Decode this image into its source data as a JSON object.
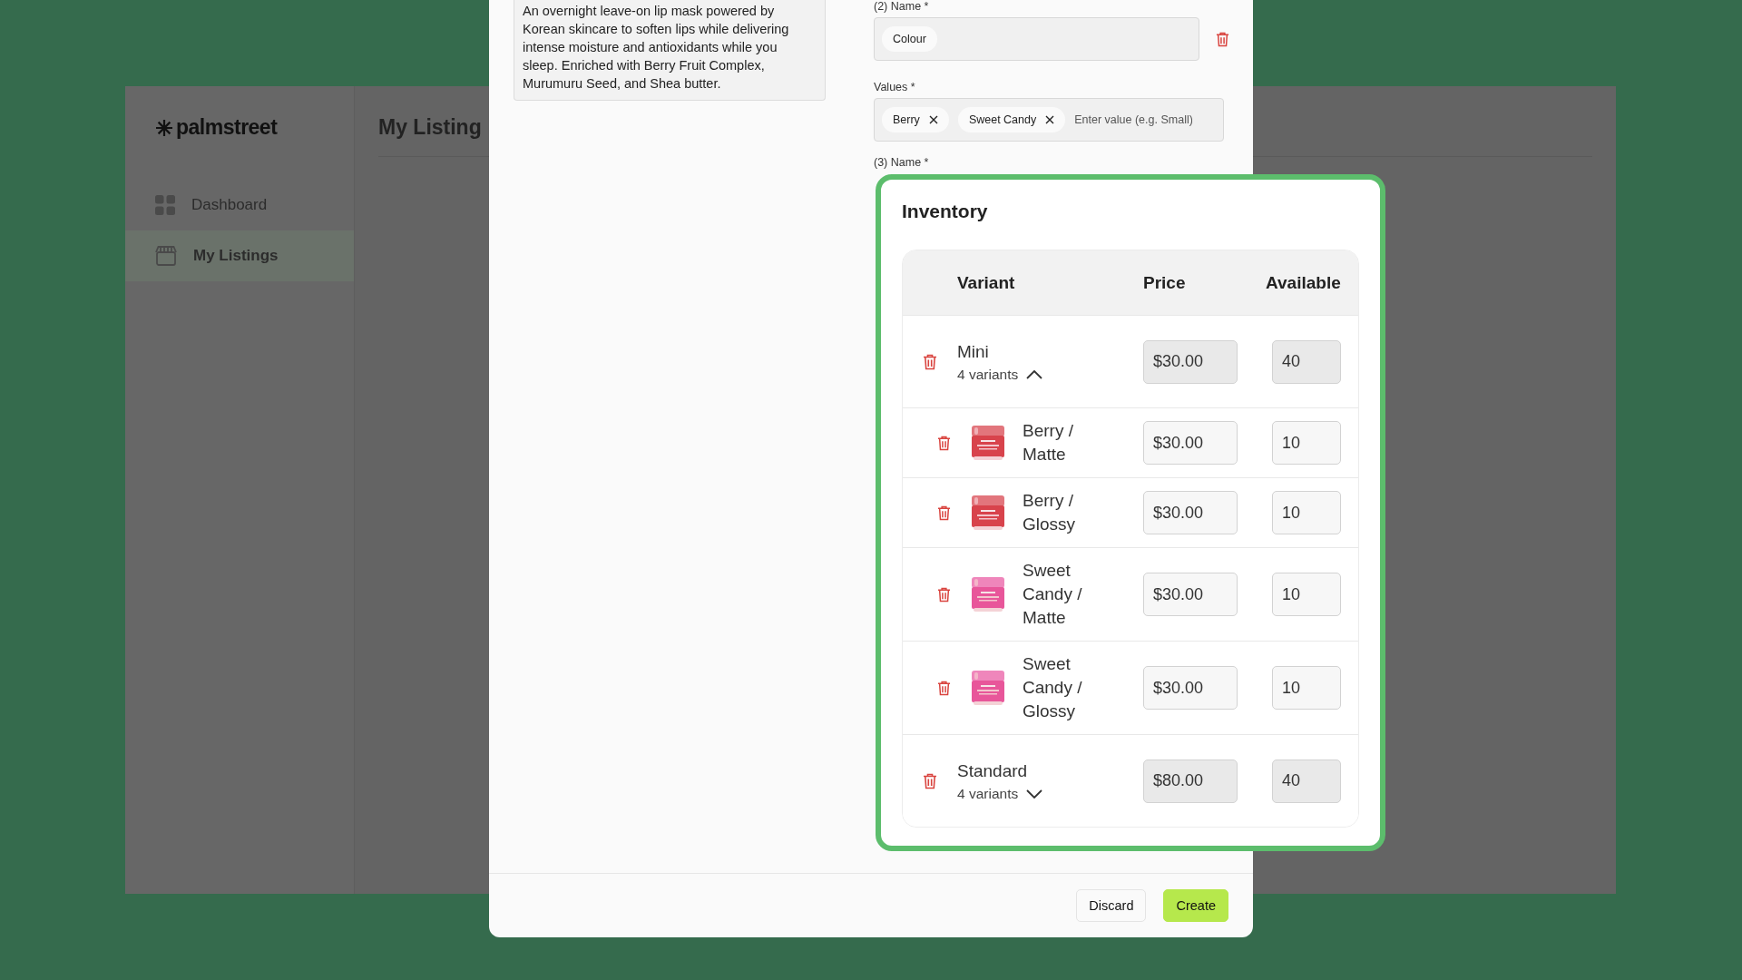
{
  "sidebar": {
    "logo": "palmstreet",
    "items": [
      {
        "label": "Dashboard",
        "kind": "dashboard",
        "selected": false
      },
      {
        "label": "My Listings",
        "kind": "listings",
        "selected": true
      }
    ]
  },
  "page": {
    "title": "My Listing"
  },
  "modal": {
    "description": "An overnight leave-on lip mask powered by Korean skincare to soften lips while delivering intense moisture and antioxidants while you sleep. Enriched with Berry Fruit Complex, Murumuru Seed, and Shea butter.",
    "option_name": {
      "label": "(2) Name *",
      "chip": "Colour"
    },
    "values": {
      "label": "Values *",
      "chips": [
        "Berry",
        "Sweet Candy"
      ],
      "placeholder": "Enter value (e.g. Small)"
    },
    "next_option_label": "(3) Name *",
    "buttons": [
      {
        "label": "Discard",
        "kind": "secondary"
      },
      {
        "label": "Create",
        "kind": "primary"
      }
    ]
  },
  "inventory": {
    "title": "Inventory",
    "columns": [
      "Variant",
      "Price",
      "Available"
    ],
    "rows": [
      {
        "kind": "group",
        "name": "Mini",
        "count": "4 variants",
        "expanded": true,
        "price": "$30.00",
        "available": "40",
        "children": [
          {
            "kind": "variant",
            "name": "Berry / Matte",
            "price": "$30.00",
            "available": "10"
          },
          {
            "kind": "variant",
            "name": "Berry / Glossy",
            "price": "$30.00",
            "available": "10"
          },
          {
            "kind": "variant",
            "name": "Sweet Candy / Matte",
            "price": "$30.00",
            "available": "10"
          },
          {
            "kind": "variant",
            "name": "Sweet Candy / Glossy",
            "price": "$30.00",
            "available": "10"
          }
        ]
      },
      {
        "kind": "group",
        "name": "Standard",
        "count": "4 variants",
        "expanded": false,
        "price": "$80.00",
        "available": "40"
      }
    ]
  }
}
